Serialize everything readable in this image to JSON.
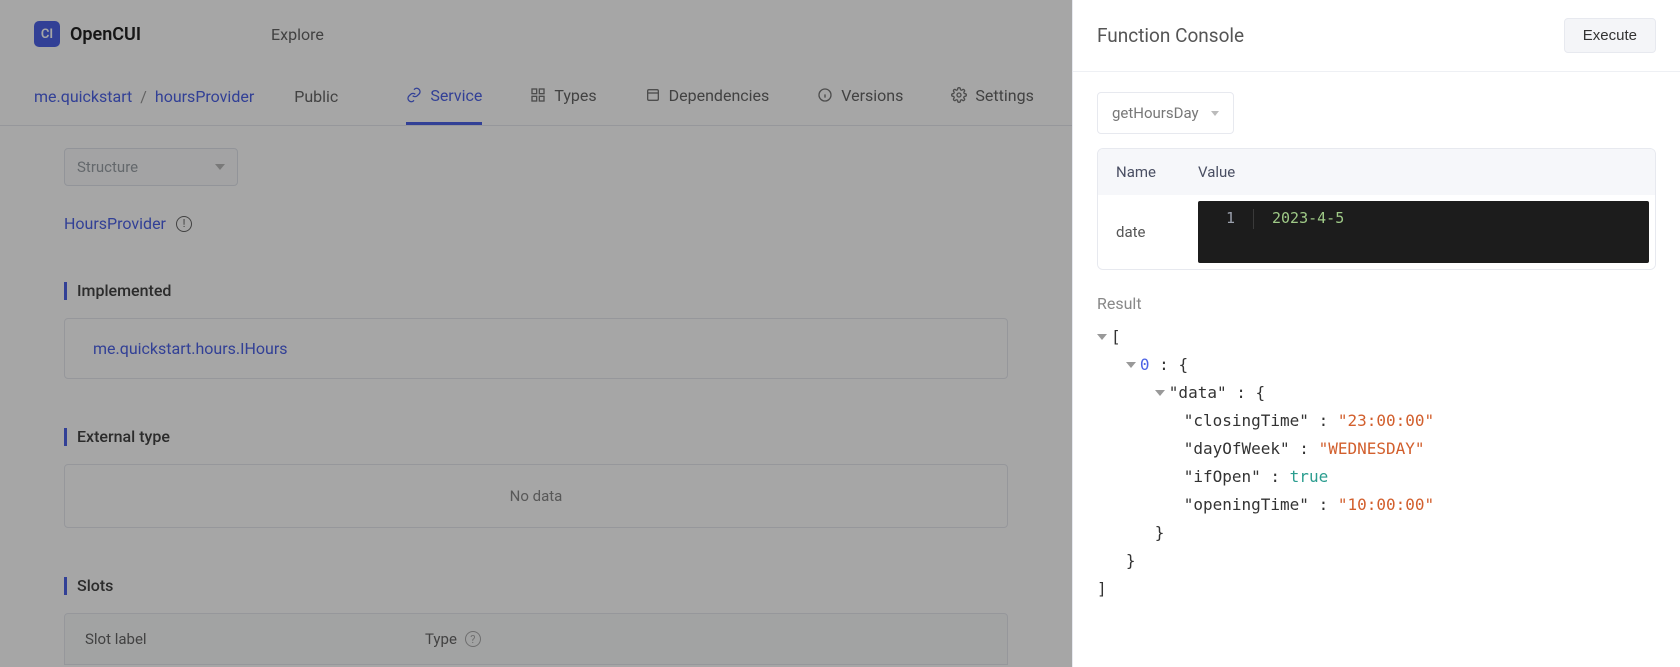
{
  "header": {
    "app_name": "OpenCUI",
    "logo_text": "CI",
    "explore": "Explore"
  },
  "breadcrumb": {
    "part1": "me.quickstart",
    "sep": "/",
    "part2": "hoursProvider",
    "public": "Public"
  },
  "tabs": {
    "service": "Service",
    "types": "Types",
    "dependencies": "Dependencies",
    "versions": "Versions",
    "settings": "Settings"
  },
  "main": {
    "structure_select": "Structure",
    "title": "HoursProvider",
    "section_implemented": "Implemented",
    "implemented_item": "me.quickstart.hours.IHours",
    "section_external": "External type",
    "no_data": "No data",
    "section_slots": "Slots",
    "slots_cols": {
      "label": "Slot label",
      "type": "Type"
    }
  },
  "console": {
    "title": "Function Console",
    "execute": "Execute",
    "fn_selected": "getHoursDay",
    "cols": {
      "name": "Name",
      "value": "Value"
    },
    "param_name": "date",
    "line_no": "1",
    "param_value": "2023-4-5",
    "result_label": "Result",
    "result": {
      "open_bracket": "[",
      "idx": "0",
      "data_key": "\"data\"",
      "rows": [
        {
          "k": "\"closingTime\"",
          "v": "\"23:00:00\"",
          "type": "str"
        },
        {
          "k": "\"dayOfWeek\"",
          "v": "\"WEDNESDAY\"",
          "type": "str"
        },
        {
          "k": "\"ifOpen\"",
          "v": "true",
          "type": "bool"
        },
        {
          "k": "\"openingTime\"",
          "v": "\"10:00:00\"",
          "type": "str"
        }
      ],
      "close_inner": "}",
      "close_obj": "}",
      "close_bracket": "]"
    }
  }
}
